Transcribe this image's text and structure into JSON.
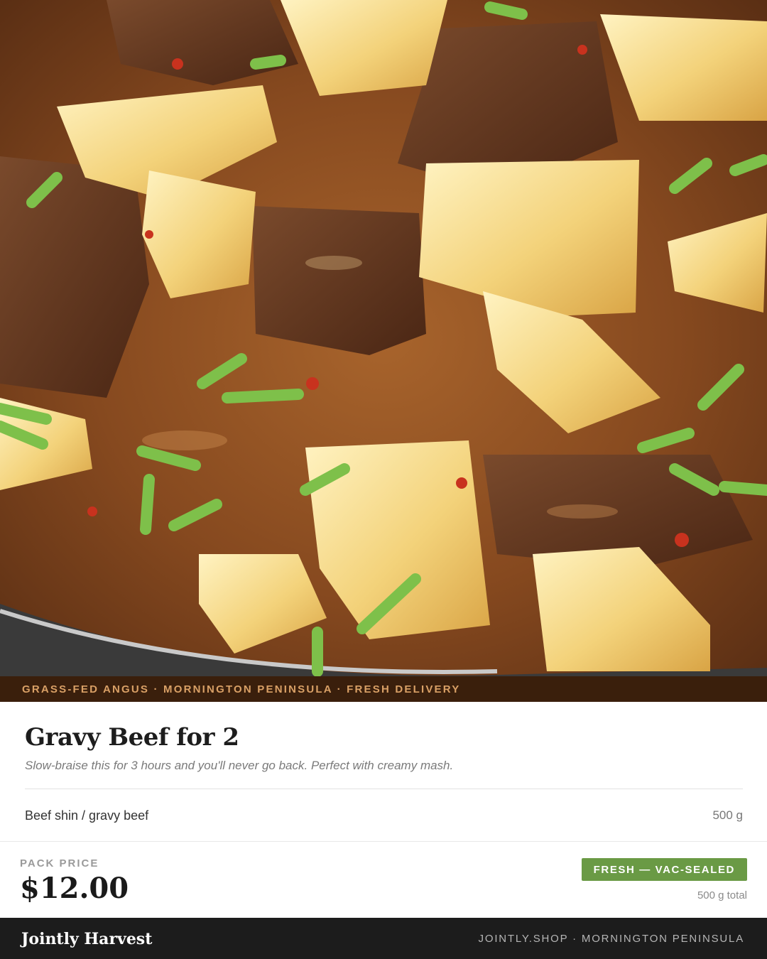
{
  "hero": {
    "alt_icon": "stew-photo"
  },
  "ribbon": {
    "text": "GRASS-FED ANGUS · MORNINGTON PENINSULA · FRESH DELIVERY"
  },
  "product": {
    "title": "Gravy Beef for 2",
    "subtitle": "Slow-braise this for 3 hours and you'll never go back. Perfect with creamy mash.",
    "items": [
      {
        "name": "Beef shin / gravy beef",
        "qty": "500 g"
      }
    ]
  },
  "pricing": {
    "label": "PACK PRICE",
    "price": "$12.00",
    "badge": "FRESH — VAC-SEALED",
    "total": "500 g total"
  },
  "footer": {
    "brand": "Jointly Harvest",
    "site": "JOINTLY.SHOP · MORNINGTON PENINSULA"
  },
  "colors": {
    "ribbon_bg": "#3a1f0c",
    "ribbon_text": "#d9a066",
    "badge_bg": "#6a9a45",
    "footer_bg": "#1c1c1c"
  }
}
